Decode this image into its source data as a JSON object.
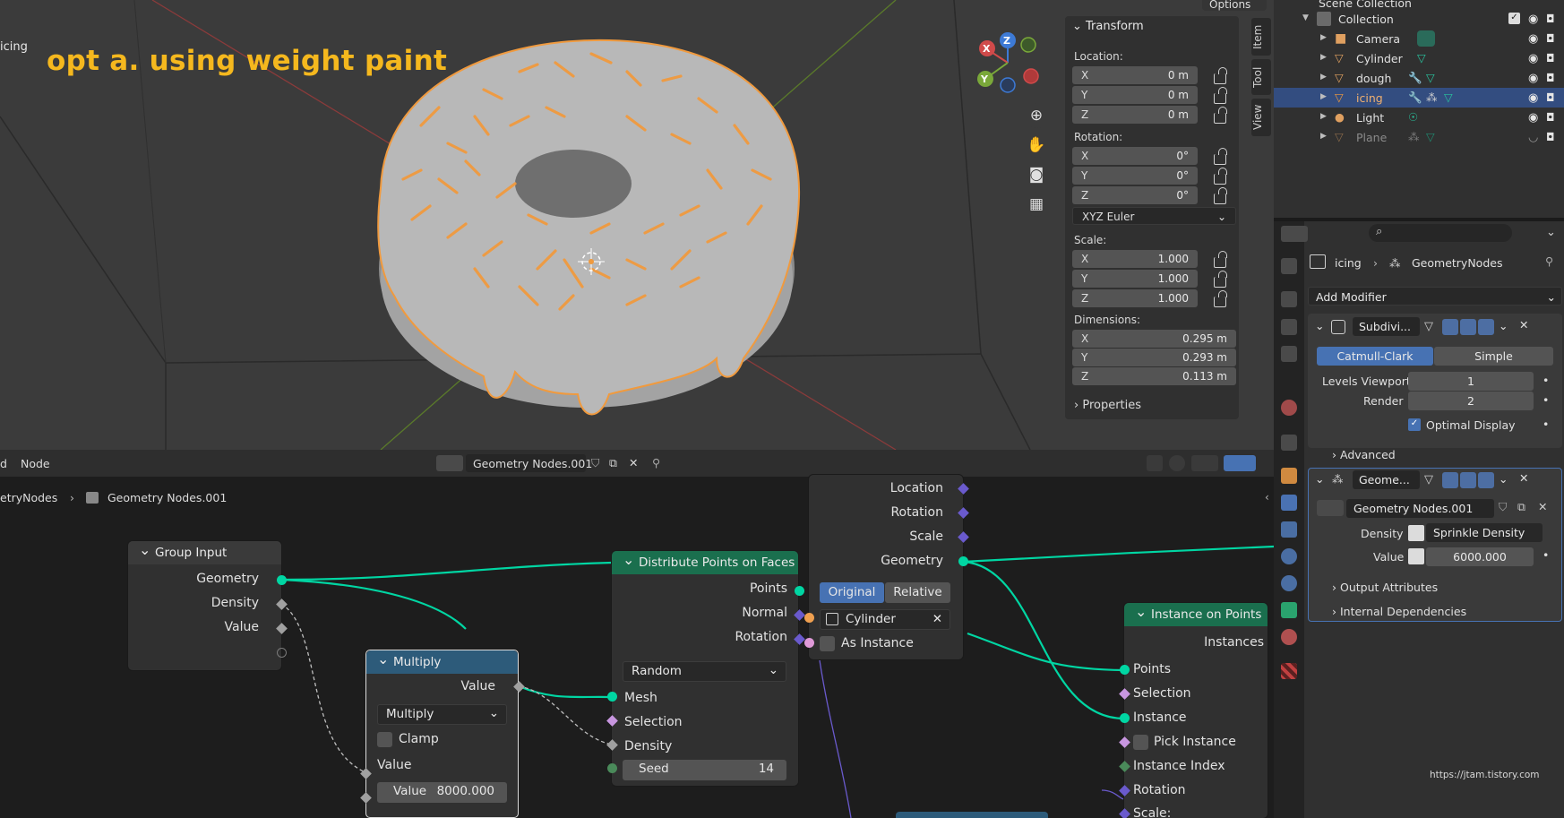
{
  "viewport": {
    "overlay_title": "opt a. using weight paint",
    "object_name": "icing",
    "options_label": "Options",
    "gizmo_axes": [
      "X",
      "Y",
      "Z"
    ],
    "nav_icons": [
      "zoom-icon",
      "hand-pan-icon",
      "camera-icon",
      "grid-icon"
    ],
    "side_tabs": [
      "Item",
      "Tool",
      "View"
    ],
    "transform_panel": {
      "title": "Transform",
      "location_label": "Location:",
      "location": [
        {
          "axis": "X",
          "value": "0 m"
        },
        {
          "axis": "Y",
          "value": "0 m"
        },
        {
          "axis": "Z",
          "value": "0 m"
        }
      ],
      "rotation_label": "Rotation:",
      "rotation": [
        {
          "axis": "X",
          "value": "0°"
        },
        {
          "axis": "Y",
          "value": "0°"
        },
        {
          "axis": "Z",
          "value": "0°"
        }
      ],
      "rotation_mode": "XYZ Euler",
      "scale_label": "Scale:",
      "scale": [
        {
          "axis": "X",
          "value": "1.000"
        },
        {
          "axis": "Y",
          "value": "1.000"
        },
        {
          "axis": "Z",
          "value": "1.000"
        }
      ],
      "dimensions_label": "Dimensions:",
      "dimensions": [
        {
          "axis": "X",
          "value": "0.295 m"
        },
        {
          "axis": "Y",
          "value": "0.293 m"
        },
        {
          "axis": "Z",
          "value": "0.113 m"
        }
      ],
      "properties_label": "Properties"
    }
  },
  "outliner": {
    "top_label": "Scene Collection",
    "collection": "Collection",
    "items": [
      {
        "name": "Camera",
        "type": "camera"
      },
      {
        "name": "Cylinder",
        "type": "mesh"
      },
      {
        "name": "dough",
        "type": "mesh"
      },
      {
        "name": "icing",
        "type": "mesh",
        "selected": true
      },
      {
        "name": "Light",
        "type": "light"
      },
      {
        "name": "Plane",
        "type": "mesh",
        "hidden": true
      }
    ]
  },
  "properties": {
    "breadcrumb_object": "icing",
    "breadcrumb_modifier": "GeometryNodes",
    "add_modifier": "Add Modifier",
    "subdiv": {
      "name": "Subdivi...",
      "mode_a": "Catmull-Clark",
      "mode_b": "Simple",
      "levels_label": "Levels Viewport",
      "levels_value": "1",
      "render_label": "Render",
      "render_value": "2",
      "optimal_label": "Optimal Display",
      "advanced_label": "Advanced"
    },
    "geonodes": {
      "name": "Geome...",
      "tree": "Geometry Nodes.001",
      "density_label": "Density",
      "density_attr": "Sprinkle Density",
      "value_label": "Value",
      "value": "6000.000",
      "output_attrs": "Output Attributes",
      "internal_deps": "Internal Dependencies"
    },
    "credit": "https://jtam.tistory.com"
  },
  "node_editor": {
    "menu_left": "d",
    "menu_node": "Node",
    "tree_name": "Geometry Nodes.001",
    "breadcrumb_a": "etryNodes",
    "breadcrumb_b": "Geometry Nodes.001",
    "group_input": {
      "title": "Group Input",
      "outputs": [
        "Geometry",
        "Density",
        "Value"
      ]
    },
    "multiply": {
      "title": "Multiply",
      "output": "Value",
      "operation": "Multiply",
      "clamp": "Clamp",
      "input_label": "Value",
      "value_label": "Value",
      "value": "8000.000"
    },
    "distribute": {
      "title": "Distribute Points on Faces",
      "outputs": [
        "Points",
        "Normal",
        "Rotation"
      ],
      "mode": "Random",
      "inputs": [
        "Mesh",
        "Selection",
        "Density"
      ],
      "seed_label": "Seed",
      "seed_value": "14"
    },
    "object_info": {
      "outputs": [
        "Location",
        "Rotation",
        "Scale",
        "Geometry"
      ],
      "mode_a": "Original",
      "mode_b": "Relative",
      "object": "Cylinder",
      "as_instance": "As Instance"
    },
    "instance_on_points": {
      "title": "Instance on Points",
      "output": "Instances",
      "inputs": [
        "Points",
        "Selection",
        "Instance",
        "Pick Instance",
        "Instance Index",
        "Rotation",
        "Scale:"
      ]
    }
  },
  "colors": {
    "title_yellow": "#f5b81e",
    "selection_orange": "#f09a3e",
    "geometry_socket": "#00d6a3",
    "node_header_green": "#1a6f4e",
    "node_header_blue": "#2d5b7a",
    "active_blue": "#4772b3"
  }
}
